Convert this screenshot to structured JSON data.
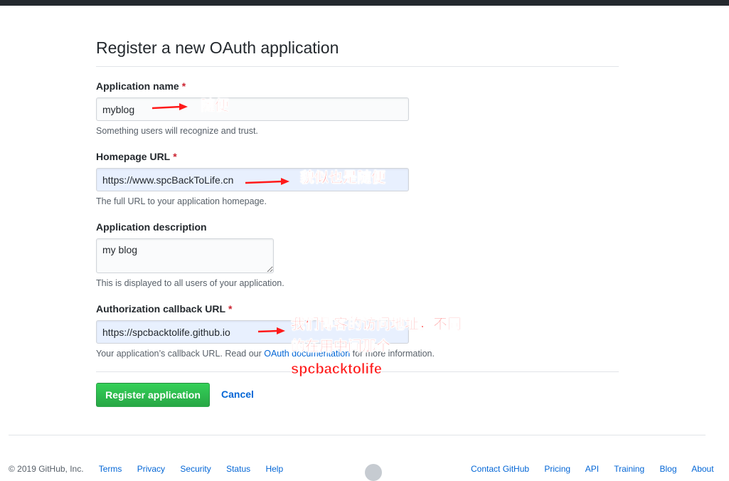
{
  "page": {
    "title": "Register a new OAuth application"
  },
  "form": {
    "app_name": {
      "label": "Application name",
      "required_mark": "*",
      "value": "myblog",
      "note": "Something users will recognize and trust."
    },
    "homepage_url": {
      "label": "Homepage URL",
      "required_mark": "*",
      "value": "https://www.spcBackToLife.cn",
      "note": "The full URL to your application homepage."
    },
    "description": {
      "label": "Application description",
      "value": "my blog",
      "note": "This is displayed to all users of your application."
    },
    "callback_url": {
      "label": "Authorization callback URL",
      "required_mark": "*",
      "value": "https://spcbacktolife.github.io",
      "note_prefix": "Your application’s callback URL. Read our ",
      "note_link": "OAuth documentation",
      "note_suffix": " for more information."
    }
  },
  "actions": {
    "register_label": "Register application",
    "cancel_label": "Cancel"
  },
  "annotations": {
    "app_name": "随便",
    "homepage": "貌似也是随便",
    "callback_line1": "我们博客的访问地址，不同",
    "callback_line2": "的在用中间那个",
    "callback_line3": "spcbacktolife"
  },
  "footer": {
    "copyright": "© 2019 GitHub, Inc.",
    "left_links": [
      "Terms",
      "Privacy",
      "Security",
      "Status",
      "Help"
    ],
    "right_links": [
      "Contact GitHub",
      "Pricing",
      "API",
      "Training",
      "Blog",
      "About"
    ]
  },
  "colors": {
    "primary_button": "#28a745",
    "link": "#0366d6",
    "required": "#cb2431",
    "annotation": "#ff1a1a"
  }
}
